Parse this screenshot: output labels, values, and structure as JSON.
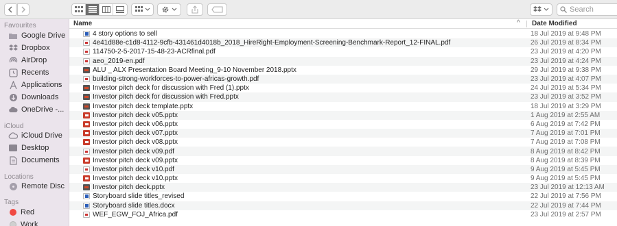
{
  "toolbar": {
    "back_icon": "chevron-left-icon",
    "forward_icon": "chevron-right-icon",
    "view_modes": [
      "icon-view",
      "list-view",
      "column-view",
      "gallery-view"
    ],
    "active_view": "list-view",
    "search": {
      "placeholder": "Search",
      "value": ""
    }
  },
  "sidebar": {
    "sections": [
      {
        "title": "Favourites"
      },
      {
        "title": "iCloud"
      },
      {
        "title": "Locations"
      },
      {
        "title": "Tags"
      }
    ],
    "favourites": [
      {
        "label": "Google Drive",
        "icon": "folder-icon"
      },
      {
        "label": "Dropbox",
        "icon": "dropbox-icon"
      },
      {
        "label": "AirDrop",
        "icon": "airdrop-icon"
      },
      {
        "label": "Recents",
        "icon": "clock-icon"
      },
      {
        "label": "Applications",
        "icon": "applications-icon"
      },
      {
        "label": "Downloads",
        "icon": "download-icon"
      },
      {
        "label": "OneDrive -...",
        "icon": "cloud-icon"
      }
    ],
    "icloud": [
      {
        "label": "iCloud Drive",
        "icon": "cloud-icon"
      },
      {
        "label": "Desktop",
        "icon": "desktop-icon"
      },
      {
        "label": "Documents",
        "icon": "document-icon"
      }
    ],
    "locations": [
      {
        "label": "Remote Disc",
        "icon": "disc-icon"
      }
    ],
    "tags": [
      {
        "label": "Red",
        "color": "#f04a43"
      },
      {
        "label": "Work",
        "color": "#d0d0d0"
      }
    ]
  },
  "file_list": {
    "headers": {
      "name": "Name",
      "date": "Date Modified",
      "sort_indicator": "^"
    },
    "files": [
      {
        "name": "4 story options to sell",
        "date": "18 Jul 2019 at 9:48 PM",
        "type": "docx"
      },
      {
        "name": "4e41d88e-c1d8-4112-9cfb-431461d4018b_2018_HireRight-Employment-Screening-Benchmark-Report_12-FINAL.pdf",
        "date": "26 Jul 2019 at 8:34 PM",
        "type": "pdf"
      },
      {
        "name": "114750-2-5-2017-15-48-23-ACRfinal.pdf",
        "date": "23 Jul 2019 at 4:20 PM",
        "type": "pdf"
      },
      {
        "name": "aeo_2019-en.pdf",
        "date": "23 Jul 2019 at 4:24 PM",
        "type": "pdf"
      },
      {
        "name": "ALU _ ALX Presentation Board Meeting_9-10 November 2018.pptx",
        "date": "29 Jul 2019 at 9:38 PM",
        "type": "pptx"
      },
      {
        "name": "building-strong-workforces-to-power-africas-growth.pdf",
        "date": "23 Jul 2019 at 4:07 PM",
        "type": "pdf"
      },
      {
        "name": "Investor pitch deck for discussion with Fred (1).pptx",
        "date": "24 Jul 2019 at 5:34 PM",
        "type": "pptx"
      },
      {
        "name": "Investor pitch deck for discussion with Fred.pptx",
        "date": "23 Jul 2019 at 3:52 PM",
        "type": "pptx"
      },
      {
        "name": "Investor pitch deck template.pptx",
        "date": "18 Jul 2019 at 3:29 PM",
        "type": "pptx"
      },
      {
        "name": "Investor pitch deck v05.pptx",
        "date": "1 Aug 2019 at 2:55 AM",
        "type": "pptx-red"
      },
      {
        "name": "Investor pitch deck v06.pptx",
        "date": "6 Aug 2019 at 7:42 PM",
        "type": "pptx-red"
      },
      {
        "name": "Investor pitch deck v07.pptx",
        "date": "7 Aug 2019 at 7:01 PM",
        "type": "pptx-red"
      },
      {
        "name": "Investor pitch deck v08.pptx",
        "date": "7 Aug 2019 at 7:08 PM",
        "type": "pptx-red"
      },
      {
        "name": "Investor pitch deck v09.pdf",
        "date": "8 Aug 2019 at 8:42 PM",
        "type": "pdf"
      },
      {
        "name": "Investor pitch deck v09.pptx",
        "date": "8 Aug 2019 at 8:39 PM",
        "type": "pptx-red"
      },
      {
        "name": "Investor pitch deck v10.pdf",
        "date": "9 Aug 2019 at 5:45 PM",
        "type": "pdf"
      },
      {
        "name": "Investor pitch deck v10.pptx",
        "date": "9 Aug 2019 at 5:45 PM",
        "type": "pptx-red"
      },
      {
        "name": "Investor pitch deck.pptx",
        "date": "23 Jul 2019 at 12:13 AM",
        "type": "pptx"
      },
      {
        "name": "Storyboard slide titles_revised",
        "date": "22 Jul 2019 at 7:56 PM",
        "type": "docx"
      },
      {
        "name": "Storyboard slide titles.docx",
        "date": "22 Jul 2019 at 7:44 PM",
        "type": "docx"
      },
      {
        "name": "WEF_EGW_FOJ_Africa.pdf",
        "date": "23 Jul 2019 at 2:57 PM",
        "type": "pdf"
      }
    ]
  }
}
